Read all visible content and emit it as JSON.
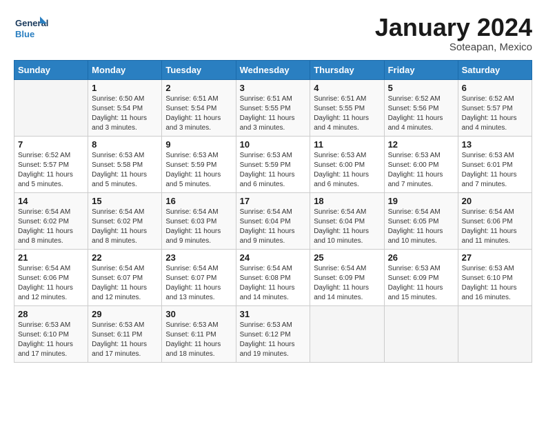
{
  "header": {
    "logo_line1": "General",
    "logo_line2": "Blue",
    "month_title": "January 2024",
    "location": "Soteapan, Mexico"
  },
  "weekdays": [
    "Sunday",
    "Monday",
    "Tuesday",
    "Wednesday",
    "Thursday",
    "Friday",
    "Saturday"
  ],
  "weeks": [
    [
      {
        "day": "",
        "sunrise": "",
        "sunset": "",
        "daylight": ""
      },
      {
        "day": "1",
        "sunrise": "Sunrise: 6:50 AM",
        "sunset": "Sunset: 5:54 PM",
        "daylight": "Daylight: 11 hours and 3 minutes."
      },
      {
        "day": "2",
        "sunrise": "Sunrise: 6:51 AM",
        "sunset": "Sunset: 5:54 PM",
        "daylight": "Daylight: 11 hours and 3 minutes."
      },
      {
        "day": "3",
        "sunrise": "Sunrise: 6:51 AM",
        "sunset": "Sunset: 5:55 PM",
        "daylight": "Daylight: 11 hours and 3 minutes."
      },
      {
        "day": "4",
        "sunrise": "Sunrise: 6:51 AM",
        "sunset": "Sunset: 5:55 PM",
        "daylight": "Daylight: 11 hours and 4 minutes."
      },
      {
        "day": "5",
        "sunrise": "Sunrise: 6:52 AM",
        "sunset": "Sunset: 5:56 PM",
        "daylight": "Daylight: 11 hours and 4 minutes."
      },
      {
        "day": "6",
        "sunrise": "Sunrise: 6:52 AM",
        "sunset": "Sunset: 5:57 PM",
        "daylight": "Daylight: 11 hours and 4 minutes."
      }
    ],
    [
      {
        "day": "7",
        "sunrise": "Sunrise: 6:52 AM",
        "sunset": "Sunset: 5:57 PM",
        "daylight": "Daylight: 11 hours and 5 minutes."
      },
      {
        "day": "8",
        "sunrise": "Sunrise: 6:53 AM",
        "sunset": "Sunset: 5:58 PM",
        "daylight": "Daylight: 11 hours and 5 minutes."
      },
      {
        "day": "9",
        "sunrise": "Sunrise: 6:53 AM",
        "sunset": "Sunset: 5:59 PM",
        "daylight": "Daylight: 11 hours and 5 minutes."
      },
      {
        "day": "10",
        "sunrise": "Sunrise: 6:53 AM",
        "sunset": "Sunset: 5:59 PM",
        "daylight": "Daylight: 11 hours and 6 minutes."
      },
      {
        "day": "11",
        "sunrise": "Sunrise: 6:53 AM",
        "sunset": "Sunset: 6:00 PM",
        "daylight": "Daylight: 11 hours and 6 minutes."
      },
      {
        "day": "12",
        "sunrise": "Sunrise: 6:53 AM",
        "sunset": "Sunset: 6:00 PM",
        "daylight": "Daylight: 11 hours and 7 minutes."
      },
      {
        "day": "13",
        "sunrise": "Sunrise: 6:53 AM",
        "sunset": "Sunset: 6:01 PM",
        "daylight": "Daylight: 11 hours and 7 minutes."
      }
    ],
    [
      {
        "day": "14",
        "sunrise": "Sunrise: 6:54 AM",
        "sunset": "Sunset: 6:02 PM",
        "daylight": "Daylight: 11 hours and 8 minutes."
      },
      {
        "day": "15",
        "sunrise": "Sunrise: 6:54 AM",
        "sunset": "Sunset: 6:02 PM",
        "daylight": "Daylight: 11 hours and 8 minutes."
      },
      {
        "day": "16",
        "sunrise": "Sunrise: 6:54 AM",
        "sunset": "Sunset: 6:03 PM",
        "daylight": "Daylight: 11 hours and 9 minutes."
      },
      {
        "day": "17",
        "sunrise": "Sunrise: 6:54 AM",
        "sunset": "Sunset: 6:04 PM",
        "daylight": "Daylight: 11 hours and 9 minutes."
      },
      {
        "day": "18",
        "sunrise": "Sunrise: 6:54 AM",
        "sunset": "Sunset: 6:04 PM",
        "daylight": "Daylight: 11 hours and 10 minutes."
      },
      {
        "day": "19",
        "sunrise": "Sunrise: 6:54 AM",
        "sunset": "Sunset: 6:05 PM",
        "daylight": "Daylight: 11 hours and 10 minutes."
      },
      {
        "day": "20",
        "sunrise": "Sunrise: 6:54 AM",
        "sunset": "Sunset: 6:06 PM",
        "daylight": "Daylight: 11 hours and 11 minutes."
      }
    ],
    [
      {
        "day": "21",
        "sunrise": "Sunrise: 6:54 AM",
        "sunset": "Sunset: 6:06 PM",
        "daylight": "Daylight: 11 hours and 12 minutes."
      },
      {
        "day": "22",
        "sunrise": "Sunrise: 6:54 AM",
        "sunset": "Sunset: 6:07 PM",
        "daylight": "Daylight: 11 hours and 12 minutes."
      },
      {
        "day": "23",
        "sunrise": "Sunrise: 6:54 AM",
        "sunset": "Sunset: 6:07 PM",
        "daylight": "Daylight: 11 hours and 13 minutes."
      },
      {
        "day": "24",
        "sunrise": "Sunrise: 6:54 AM",
        "sunset": "Sunset: 6:08 PM",
        "daylight": "Daylight: 11 hours and 14 minutes."
      },
      {
        "day": "25",
        "sunrise": "Sunrise: 6:54 AM",
        "sunset": "Sunset: 6:09 PM",
        "daylight": "Daylight: 11 hours and 14 minutes."
      },
      {
        "day": "26",
        "sunrise": "Sunrise: 6:53 AM",
        "sunset": "Sunset: 6:09 PM",
        "daylight": "Daylight: 11 hours and 15 minutes."
      },
      {
        "day": "27",
        "sunrise": "Sunrise: 6:53 AM",
        "sunset": "Sunset: 6:10 PM",
        "daylight": "Daylight: 11 hours and 16 minutes."
      }
    ],
    [
      {
        "day": "28",
        "sunrise": "Sunrise: 6:53 AM",
        "sunset": "Sunset: 6:10 PM",
        "daylight": "Daylight: 11 hours and 17 minutes."
      },
      {
        "day": "29",
        "sunrise": "Sunrise: 6:53 AM",
        "sunset": "Sunset: 6:11 PM",
        "daylight": "Daylight: 11 hours and 17 minutes."
      },
      {
        "day": "30",
        "sunrise": "Sunrise: 6:53 AM",
        "sunset": "Sunset: 6:11 PM",
        "daylight": "Daylight: 11 hours and 18 minutes."
      },
      {
        "day": "31",
        "sunrise": "Sunrise: 6:53 AM",
        "sunset": "Sunset: 6:12 PM",
        "daylight": "Daylight: 11 hours and 19 minutes."
      },
      {
        "day": "",
        "sunrise": "",
        "sunset": "",
        "daylight": ""
      },
      {
        "day": "",
        "sunrise": "",
        "sunset": "",
        "daylight": ""
      },
      {
        "day": "",
        "sunrise": "",
        "sunset": "",
        "daylight": ""
      }
    ]
  ]
}
